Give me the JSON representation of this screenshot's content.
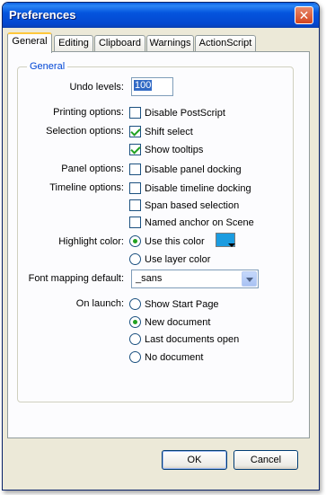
{
  "window": {
    "title": "Preferences",
    "close_glyph": "✕"
  },
  "tabs": [
    {
      "label": "General",
      "active": true
    },
    {
      "label": "Editing",
      "active": false
    },
    {
      "label": "Clipboard",
      "active": false
    },
    {
      "label": "Warnings",
      "active": false
    },
    {
      "label": "ActionScript",
      "active": false
    }
  ],
  "group": {
    "title": "General"
  },
  "undo": {
    "label": "Undo levels:",
    "value": "100"
  },
  "printing": {
    "label": "Printing options:",
    "option": "Disable PostScript",
    "checked": false
  },
  "selection": {
    "label": "Selection options:",
    "shift_select": {
      "label": "Shift select",
      "checked": true
    },
    "show_tooltips": {
      "label": "Show tooltips",
      "checked": true
    }
  },
  "panel": {
    "label": "Panel options:",
    "option": "Disable panel docking",
    "checked": false
  },
  "timeline": {
    "label": "Timeline options:",
    "disable_docking": {
      "label": "Disable timeline docking",
      "checked": false
    },
    "span_selection": {
      "label": "Span based selection",
      "checked": false
    },
    "named_anchor": {
      "label": "Named anchor on Scene",
      "checked": false
    }
  },
  "highlight": {
    "label": "Highlight color:",
    "use_this": {
      "label": "Use this color",
      "selected": true
    },
    "use_layer": {
      "label": "Use layer color",
      "selected": false
    },
    "swatch_color": "#1b9ce0"
  },
  "font_mapping": {
    "label": "Font mapping default:",
    "value": "_sans"
  },
  "on_launch": {
    "label": "On launch:",
    "options": [
      {
        "label": "Show Start Page",
        "selected": false
      },
      {
        "label": "New document",
        "selected": true
      },
      {
        "label": "Last documents open",
        "selected": false
      },
      {
        "label": "No document",
        "selected": false
      }
    ]
  },
  "buttons": {
    "ok": "OK",
    "cancel": "Cancel"
  },
  "colors": {
    "titlebar": "#0555de",
    "accent_tab": "#ffc83c",
    "group_title": "#0046d5",
    "check_mark": "#21a121"
  }
}
